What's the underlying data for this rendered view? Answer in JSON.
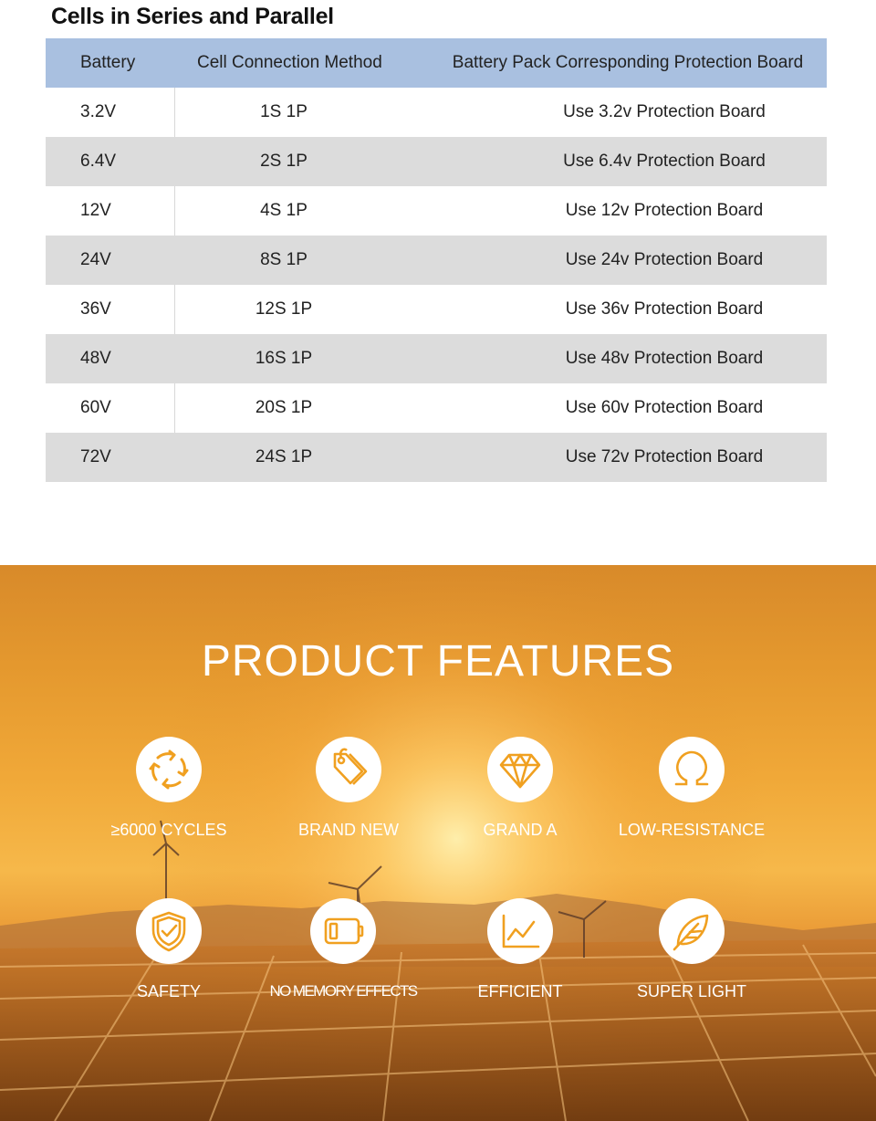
{
  "table": {
    "title": "Cells in Series and Parallel",
    "headers": [
      "Battery",
      "Cell Connection Method",
      "Battery Pack Corresponding Protection Board"
    ],
    "rows": [
      [
        "3.2V",
        "1S  1P",
        "Use 3.2v Protection Board"
      ],
      [
        "6.4V",
        "2S  1P",
        "Use 6.4v Protection Board"
      ],
      [
        "12V",
        "4S  1P",
        "Use 12v Protection Board"
      ],
      [
        "24V",
        "8S  1P",
        "Use 24v Protection Board"
      ],
      [
        "36V",
        "12S 1P",
        "Use 36v Protection Board"
      ],
      [
        "48V",
        "16S 1P",
        "Use 48v Protection Board"
      ],
      [
        "60V",
        "20S 1P",
        "Use 60v Protection Board"
      ],
      [
        "72V",
        "24S 1P",
        "Use 72v Protection Board"
      ]
    ]
  },
  "features": {
    "title": "PRODUCT FEATURES",
    "icon_color": "#f0a020",
    "items": [
      {
        "label": "≥6000 CYCLES",
        "icon": "cycle-arrows-icon"
      },
      {
        "label": "BRAND NEW",
        "icon": "price-tags-icon"
      },
      {
        "label": "GRAND A",
        "icon": "diamond-icon"
      },
      {
        "label": "LOW-RESISTANCE",
        "icon": "omega-icon"
      },
      {
        "label": "SAFETY",
        "icon": "shield-check-icon"
      },
      {
        "label": "NO MEMORY EFFECTS",
        "icon": "battery-icon"
      },
      {
        "label": "EFFICIENT",
        "icon": "line-chart-icon"
      },
      {
        "label": "SUPER LIGHT",
        "icon": "feather-icon"
      }
    ]
  }
}
